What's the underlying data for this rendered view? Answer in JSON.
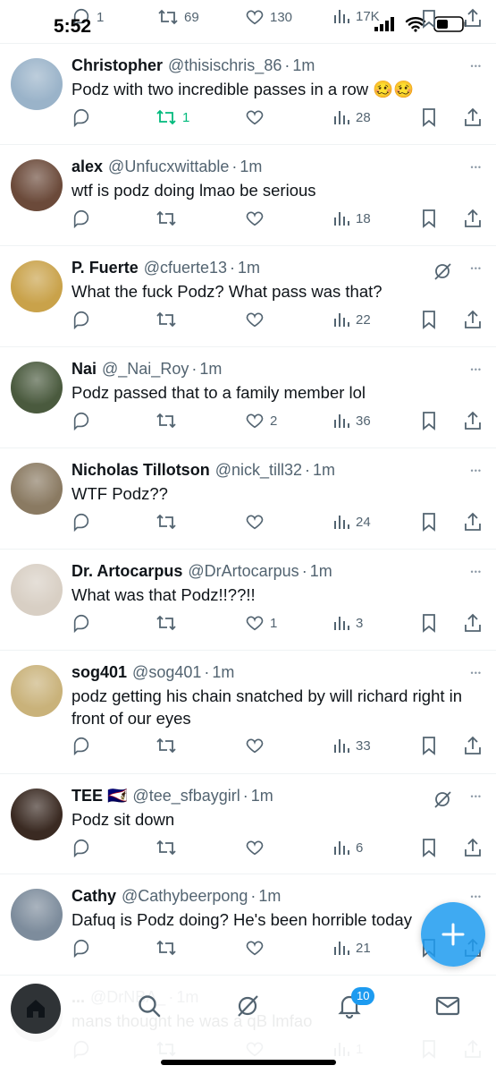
{
  "status_bar": {
    "time": "5:52"
  },
  "top_partial": {
    "reply_count": "1",
    "retweet_count": "69",
    "like_count": "130",
    "views": "17K"
  },
  "tweets": [
    {
      "name": "Christopher",
      "handle": "@thisischris_86",
      "time": "1m",
      "text": "Podz with two incredible passes in a row 🥴🥴",
      "reply": "",
      "retweet": "1",
      "like": "",
      "views": "28",
      "retweeted": true,
      "grok": false,
      "avatar_color": "#9ab3c9"
    },
    {
      "name": "alex",
      "handle": "@Unfucxwittable",
      "time": "1m",
      "text": "wtf is podz doing lmao be serious",
      "reply": "",
      "retweet": "",
      "like": "",
      "views": "18",
      "retweeted": false,
      "grok": false,
      "avatar_color": "#6b4a3a"
    },
    {
      "name": "P. Fuerte",
      "handle": "@cfuerte13",
      "time": "1m",
      "text": "What the fuck Podz? What pass was that?",
      "reply": "",
      "retweet": "",
      "like": "",
      "views": "22",
      "retweeted": false,
      "grok": true,
      "avatar_color": "#c9a24a"
    },
    {
      "name": "Nai",
      "handle": "@_Nai_Roy",
      "time": "1m",
      "text": "Podz passed that to a family member lol",
      "reply": "",
      "retweet": "",
      "like": "2",
      "views": "36",
      "retweeted": false,
      "grok": false,
      "avatar_color": "#4a5a3e"
    },
    {
      "name": "Nicholas Tillotson",
      "handle": "@nick_till32",
      "time": "1m",
      "text": "WTF Podz??",
      "reply": "",
      "retweet": "",
      "like": "",
      "views": "24",
      "retweeted": false,
      "grok": false,
      "avatar_color": "#8a7a62"
    },
    {
      "name": "Dr. Artocarpus",
      "handle": "@DrArtocarpus",
      "time": "1m",
      "text": "What was that Podz!!??!!",
      "reply": "",
      "retweet": "",
      "like": "1",
      "views": "3",
      "retweeted": false,
      "grok": false,
      "avatar_color": "#d8cfc4"
    },
    {
      "name": "sog401",
      "handle": "@sog401",
      "time": "1m",
      "text": "podz getting his chain snatched by will richard right in front of our eyes",
      "reply": "",
      "retweet": "",
      "like": "",
      "views": "33",
      "retweeted": false,
      "grok": false,
      "avatar_color": "#c9b27a"
    },
    {
      "name": "TEE 🇦🇸",
      "handle": "@tee_sfbaygirl",
      "time": "1m",
      "text": "Podz sit down",
      "reply": "",
      "retweet": "",
      "like": "",
      "views": "6",
      "retweeted": false,
      "grok": true,
      "avatar_color": "#3a2a22"
    },
    {
      "name": "Cathy",
      "handle": "@Cathybeerpong",
      "time": "1m",
      "text": "Dafuq is Podz doing? He's been horrible today",
      "reply": "",
      "retweet": "",
      "like": "",
      "views": "21",
      "retweeted": false,
      "grok": false,
      "avatar_color": "#7d8c9c"
    },
    {
      "name": "...",
      "handle": "@DrNBA_",
      "time": "1m",
      "text": "mans thought he was a qB lmfao",
      "reply": "",
      "retweet": "",
      "like": "",
      "views": "1",
      "retweeted": false,
      "grok": false,
      "avatar_color": "#b0b0b0"
    }
  ],
  "bottom_nav": {
    "notifications_badge": "10"
  },
  "colors": {
    "accent": "#1d9bf0",
    "retweet_active": "#00ba7c",
    "muted": "#536471"
  }
}
